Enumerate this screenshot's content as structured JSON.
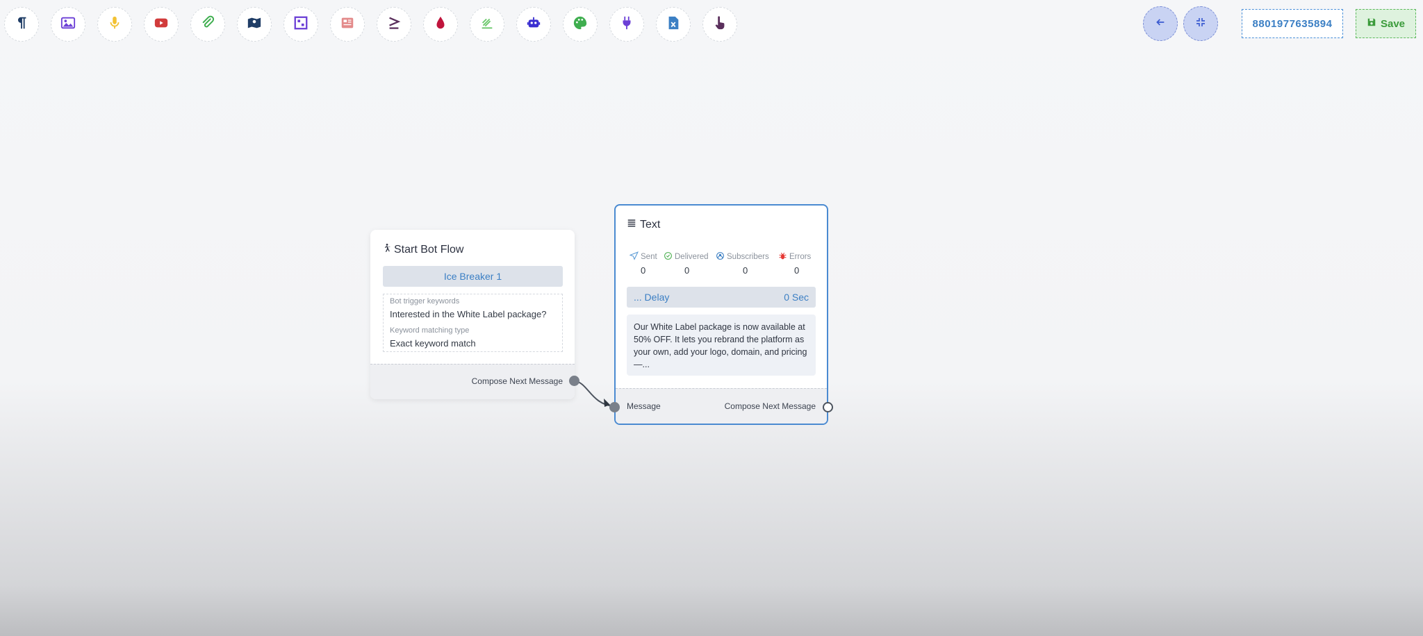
{
  "toolbar": {
    "tools": [
      {
        "name": "paragraph-icon",
        "color": "#1f3d66"
      },
      {
        "name": "image-icon",
        "color": "#6b3fd6"
      },
      {
        "name": "microphone-icon",
        "color": "#f2c233"
      },
      {
        "name": "youtube-icon",
        "color": "#d13b3b"
      },
      {
        "name": "attachment-icon",
        "color": "#3fae4f"
      },
      {
        "name": "map-icon",
        "color": "#1f3d66"
      },
      {
        "name": "gallery-icon",
        "color": "#6b3fd6"
      },
      {
        "name": "newspaper-icon",
        "color": "#e38a8a"
      },
      {
        "name": "greater-equal-icon",
        "color": "#5a2f5c"
      },
      {
        "name": "drop-icon",
        "color": "#c0143c"
      },
      {
        "name": "feed-icon",
        "color": "#6ac86a"
      },
      {
        "name": "robot-icon",
        "color": "#3b2fd1"
      },
      {
        "name": "palette-icon",
        "color": "#3fae4f"
      },
      {
        "name": "plug-icon",
        "color": "#6b3fd6"
      },
      {
        "name": "excel-file-icon",
        "color": "#3b7fc4"
      },
      {
        "name": "hand-pointer-icon",
        "color": "#5a2f5c"
      }
    ]
  },
  "header": {
    "phone": "8801977635894",
    "save_label": "Save",
    "back_icon": "arrow-left-icon",
    "compress_icon": "compress-icon"
  },
  "start_node": {
    "title": "Start Bot Flow",
    "chip": "Ice Breaker 1",
    "keywords_label": "Bot trigger keywords",
    "keywords_value": "Interested in the White Label package?",
    "match_label": "Keyword matching type",
    "match_value": "Exact keyword match",
    "output_label": "Compose Next Message"
  },
  "text_node": {
    "title": "Text",
    "stats": [
      {
        "label": "Sent",
        "value": "0",
        "icon": "paper-plane-icon",
        "color": "#5b9bd5"
      },
      {
        "label": "Delivered",
        "value": "0",
        "icon": "check-circle-icon",
        "color": "#4caf50"
      },
      {
        "label": "Subscribers",
        "value": "0",
        "icon": "user-circle-icon",
        "color": "#3b7fc4"
      },
      {
        "label": "Errors",
        "value": "0",
        "icon": "bug-icon",
        "color": "#e53935"
      }
    ],
    "delay_label": "... Delay",
    "delay_value": "0 Sec",
    "message": "Our White Label package is now available at 50% OFF. It lets you rebrand the platform as your own, add your logo, domain, and pricing —...",
    "input_label": "Message",
    "output_label": "Compose Next Message"
  }
}
